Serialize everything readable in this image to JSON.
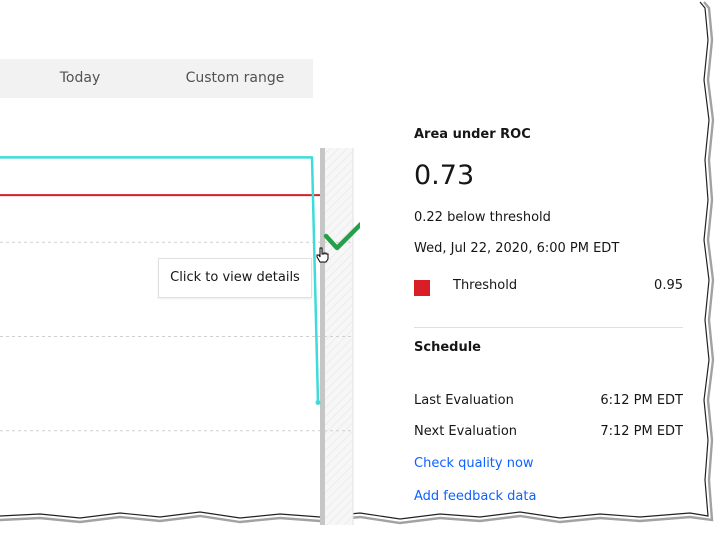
{
  "range_tabs": {
    "today": "Today",
    "custom_range": "Custom range"
  },
  "chart_data": {
    "type": "line",
    "series": [
      {
        "values": [
          0.99,
          0.99,
          0.99,
          0.99,
          0.73
        ],
        "color": "#3ddbd9"
      }
    ],
    "threshold": 0.95,
    "threshold_color": "#da1e28",
    "ylim": [
      0.6,
      1.0
    ],
    "grid": true
  },
  "tooltip": {
    "text": "Click to view details"
  },
  "metric": {
    "title": "Area under ROC",
    "value": "0.73",
    "below_threshold": "0.22 below threshold",
    "date": "Wed, Jul 22, 2020, 6:00 PM EDT",
    "threshold_label": "Threshold",
    "threshold_value": "0.95",
    "threshold_color": "#da1e28"
  },
  "schedule": {
    "title": "Schedule",
    "last_label": "Last Evaluation",
    "last_value": "6:12 PM EDT",
    "next_label": "Next Evaluation",
    "next_value": "7:12 PM EDT",
    "check_link": "Check quality now",
    "feedback_link": "Add feedback data"
  },
  "colors": {
    "accent_link": "#0f62fe",
    "check": "#24a148",
    "selection_bar": "#c6c6c6"
  },
  "icons": [
    "checkmark-icon",
    "hand-cursor-icon"
  ]
}
